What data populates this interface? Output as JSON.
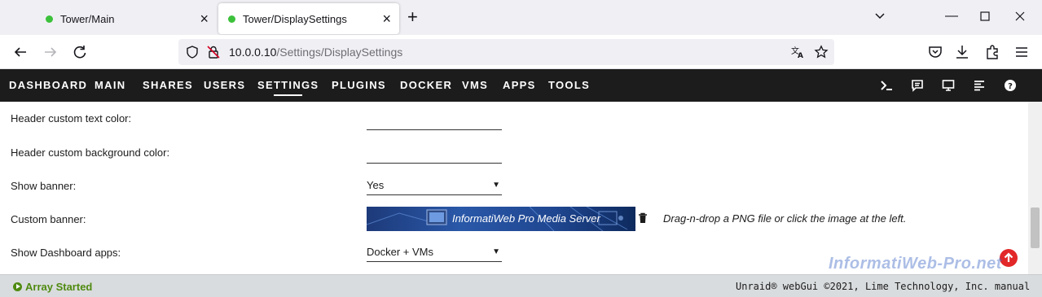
{
  "browser": {
    "tabs": [
      {
        "title": "Tower/Main",
        "active": false
      },
      {
        "title": "Tower/DisplaySettings",
        "active": true
      }
    ],
    "url": {
      "host": "10.0.0.10",
      "path": "/Settings/DisplaySettings"
    }
  },
  "menu": {
    "items": [
      "DASHBOARD",
      "MAIN",
      "SHARES",
      "USERS",
      "SETTINGS",
      "PLUGINS",
      "DOCKER",
      "VMS",
      "APPS",
      "TOOLS"
    ],
    "active": "SETTINGS",
    "icons": [
      "terminal-icon",
      "feedback-icon",
      "monitor-icon",
      "log-icon",
      "help-icon"
    ]
  },
  "settings": {
    "header_text_color_label": "Header custom text color:",
    "header_bg_color_label": "Header custom background color:",
    "show_banner_label": "Show banner:",
    "show_banner_value": "Yes",
    "custom_banner_label": "Custom banner:",
    "banner_text": "InformatiWeb Pro Media Server",
    "banner_hint": "Drag-n-drop a PNG file or click the image at the left.",
    "show_dashboard_apps_label": "Show Dashboard apps:",
    "show_dashboard_apps_value": "Docker + VMs"
  },
  "footer": {
    "status": "Array Started",
    "copyright": "Unraid® webGui ©2021, Lime Technology, Inc. manual"
  },
  "watermark": "InformatiWeb-Pro.net",
  "colors": {
    "menu_bg": "#1c1c1c",
    "status_green": "#4f8a10",
    "up_button_red": "#e22828",
    "footer_bg": "#d9dcde"
  }
}
